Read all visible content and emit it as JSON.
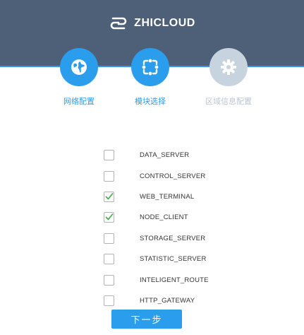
{
  "header": {
    "brand_name": "ZHICLOUD",
    "logo_icon": "cloud-link-logo"
  },
  "steps": [
    {
      "label": "网络配置",
      "icon": "globe-icon",
      "state": "completed"
    },
    {
      "label": "模块选择",
      "icon": "module-select-icon",
      "state": "active"
    },
    {
      "label": "区域信息配置",
      "icon": "gear-icon",
      "state": "inactive"
    }
  ],
  "modules": [
    {
      "label": "DATA_SERVER",
      "checked": false
    },
    {
      "label": "CONTROL_SERVER",
      "checked": false
    },
    {
      "label": "WEB_TERMINAL",
      "checked": true
    },
    {
      "label": "NODE_CLIENT",
      "checked": true
    },
    {
      "label": "STORAGE_SERVER",
      "checked": false
    },
    {
      "label": "STATISTIC_SERVER",
      "checked": false
    },
    {
      "label": "INTELIGENT_ROUTE",
      "checked": false
    },
    {
      "label": "HTTP_GATEWAY",
      "checked": false
    }
  ],
  "actions": {
    "next_label": "下一步"
  },
  "colors": {
    "header_bg": "#4e5f78",
    "accent": "#2b9ded",
    "inactive": "#c7d3df",
    "check": "#4caf50"
  }
}
